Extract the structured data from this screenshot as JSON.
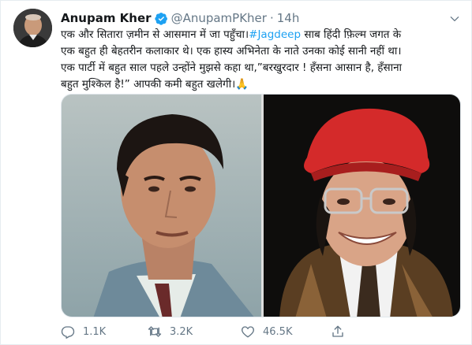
{
  "tweet": {
    "display_name": "Anupam Kher",
    "handle": "@AnupamPKher",
    "separator": "·",
    "timestamp": "14h",
    "text": {
      "line1_pre": "एक और सितारा ज़मीन से आसमान में जा पहुँचा।",
      "line1_hashtag": "#Jagdeep",
      "line1_post": " साब हिंदी फ़िल्म जगत के",
      "line2": "एक बहुत ही बेहतरीन कलाकार थे। एक हास्य अभिनेता के नाते उनका कोई सानी नहीं था।",
      "line3": "एक पार्टी में बहुत साल पहले उन्होंने मुझसे कहा था,”बरखुरदार ! हँसना आसान है, हँसाना",
      "line4": "बहुत मुश्किल है!” आपकी कमी बहुत खलेगी।🙏"
    },
    "stats": {
      "replies": "1.1K",
      "retweets": "3.2K",
      "likes": "46.5K"
    }
  },
  "colors": {
    "accent": "#1da1f2",
    "secondary_text": "#657786",
    "primary_text": "#14171a"
  },
  "icons": [
    "verified-badge-icon",
    "caret-down-icon",
    "reply-icon",
    "retweet-icon",
    "like-icon",
    "share-icon"
  ]
}
